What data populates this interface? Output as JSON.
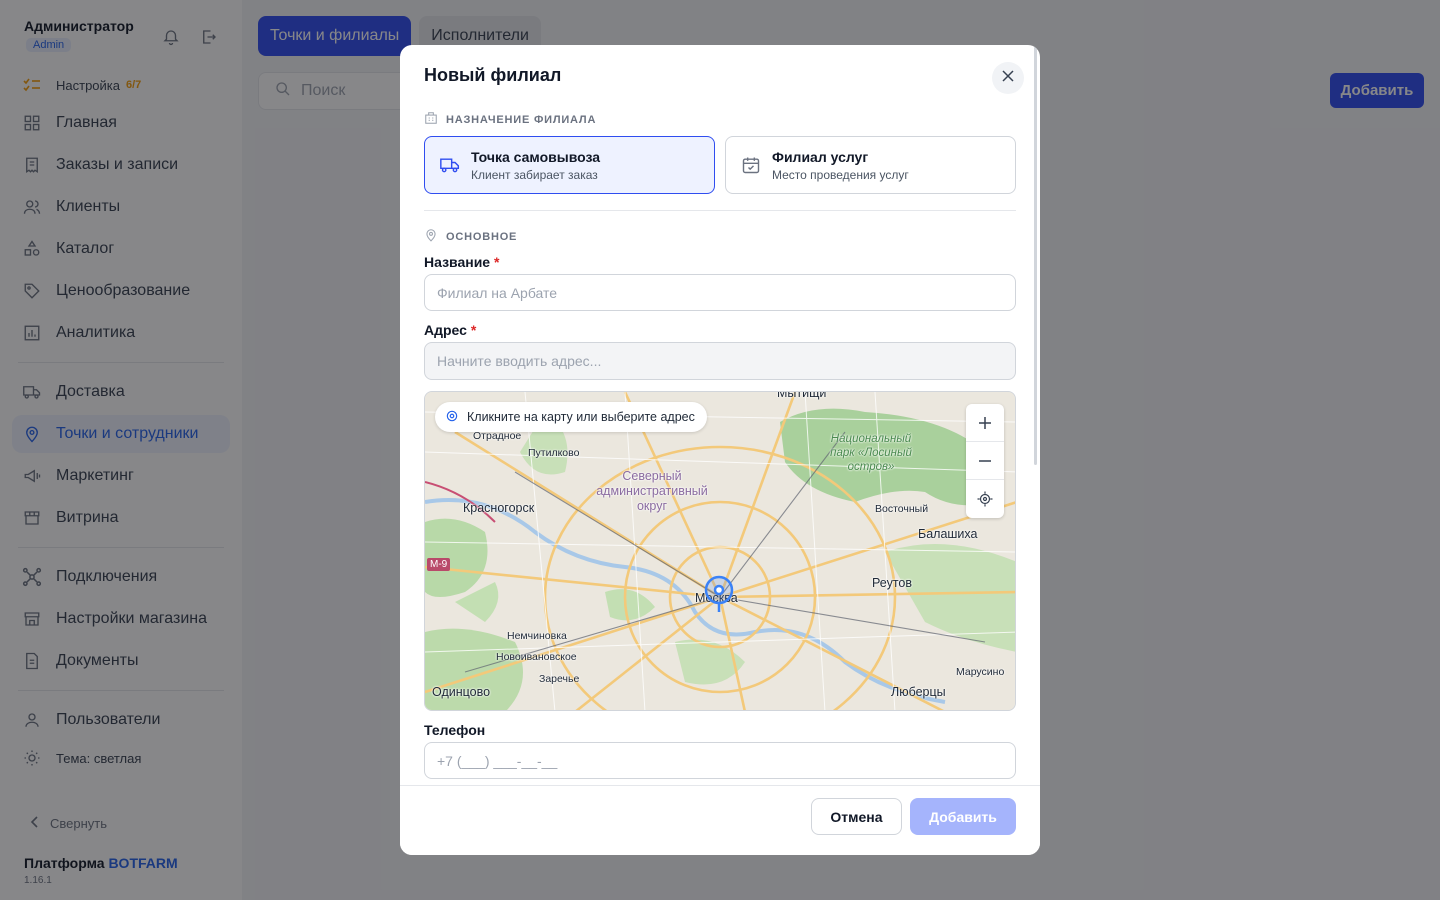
{
  "user": {
    "name": "Администратор",
    "role": "Admin"
  },
  "sidebar": {
    "setup": {
      "label": "Настройка",
      "badge": "6/7"
    },
    "items": [
      {
        "label": "Главная",
        "icon": "grid-icon"
      },
      {
        "label": "Заказы и записи",
        "icon": "receipt-icon"
      },
      {
        "label": "Клиенты",
        "icon": "users-icon"
      },
      {
        "label": "Каталог",
        "icon": "shapes-icon"
      },
      {
        "label": "Ценообразование",
        "icon": "tag-icon"
      },
      {
        "label": "Аналитика",
        "icon": "chart-icon"
      },
      {
        "label": "Доставка",
        "icon": "truck-icon"
      },
      {
        "label": "Точки и сотрудники",
        "icon": "pin-icon",
        "active": true
      },
      {
        "label": "Маркетинг",
        "icon": "megaphone-icon"
      },
      {
        "label": "Витрина",
        "icon": "store-icon"
      },
      {
        "label": "Подключения",
        "icon": "network-icon"
      },
      {
        "label": "Настройки магазина",
        "icon": "shop-settings-icon"
      },
      {
        "label": "Документы",
        "icon": "document-icon"
      },
      {
        "label": "Пользователи",
        "icon": "user-icon"
      }
    ],
    "theme": "Тема: светлая",
    "collapse": "Свернуть",
    "platform_prefix": "Платформа",
    "platform_brand": "BOTFARM",
    "version": "1.16.1"
  },
  "main": {
    "tabs": [
      "Точки и филиалы",
      "Исполнители"
    ],
    "search_placeholder": "Поиск",
    "add_label": "Добавить"
  },
  "modal": {
    "title": "Новый филиал",
    "purpose_section": "НАЗНАЧЕНИЕ ФИЛИАЛА",
    "types": [
      {
        "title": "Точка самовывоза",
        "subtitle": "Клиент забирает заказ",
        "selected": true
      },
      {
        "title": "Филиал услуг",
        "subtitle": "Место проведения услуг",
        "selected": false
      }
    ],
    "basic_section": "ОСНОВНОЕ",
    "name_label": "Название",
    "name_placeholder": "Филиал на Арбате",
    "address_label": "Адрес",
    "address_placeholder": "Начните вводить адрес...",
    "map_hint": "Кликните на карту или выберите адрес",
    "map_places": {
      "moscow": "Москва",
      "krasnogorsk": "Красногорск",
      "balashikha": "Балашиха",
      "reutov": "Реутов",
      "odintsovo": "Одинцово",
      "lyubertsy": "Люберцы",
      "mytishchi": "Мытищи",
      "otradnoe": "Отрадное",
      "putilkovo": "Путилково",
      "vostochny": "Восточный",
      "nemchinovka": "Немчиновка",
      "novoivanovskoe": "Новоивановское",
      "zarechye": "Заречье",
      "marusino": "Марусино",
      "north_district": "Северный административный округ",
      "losiny": "Национальный парк «Лосиный остров»",
      "road": "М-9"
    },
    "phone_label": "Телефон",
    "phone_placeholder": "+7 (___) ___-__-__",
    "cancel_label": "Отмена",
    "submit_label": "Добавить"
  }
}
